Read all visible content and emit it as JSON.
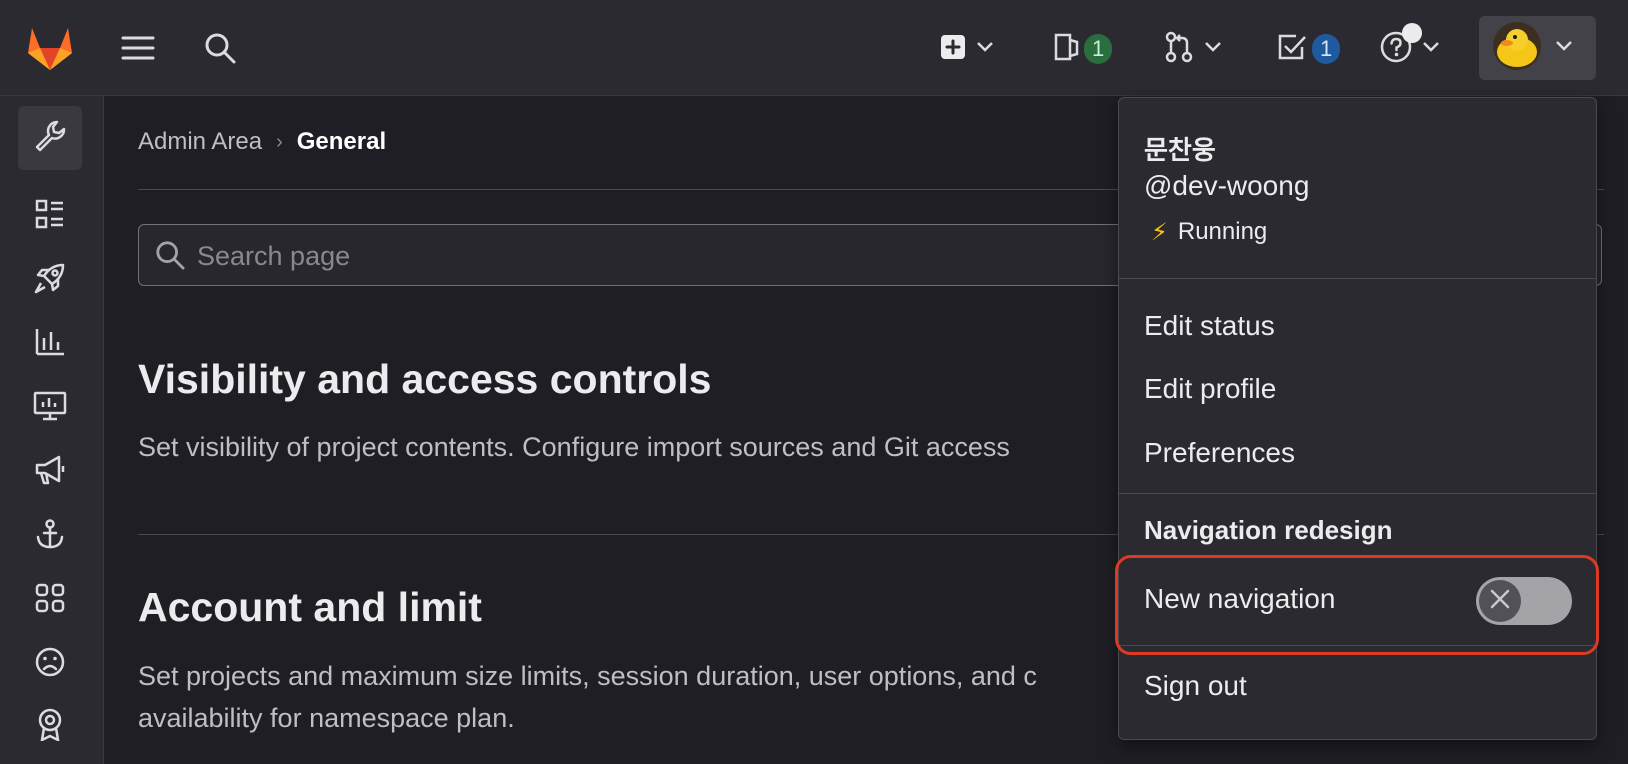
{
  "colors": {
    "brand_orange": "#fc6d26",
    "issues_badge": "#2a6e3f",
    "todos_badge": "#1f5a9e",
    "highlight_red": "#dc3b22"
  },
  "topbar": {
    "logo_icon": "gitlab-logo",
    "menu_icon": "hamburger-icon",
    "search_icon": "search-icon",
    "create_icon": "plus-square-icon",
    "issues_icon": "issues-icon",
    "issues_count": "1",
    "merge_requests_icon": "merge-request-icon",
    "todos_icon": "todo-checkbox-icon",
    "todos_count": "1",
    "help_icon": "question-circle-icon",
    "avatar_icon": "duck-avatar"
  },
  "sidebar": {
    "items": [
      {
        "icon": "wrench-icon"
      },
      {
        "icon": "overview-list-icon"
      },
      {
        "icon": "rocket-icon"
      },
      {
        "icon": "analytics-icon"
      },
      {
        "icon": "monitor-icon"
      },
      {
        "icon": "megaphone-icon"
      },
      {
        "icon": "anchor-icon"
      },
      {
        "icon": "apps-grid-icon"
      },
      {
        "icon": "abuse-face-icon"
      },
      {
        "icon": "badge-icon"
      }
    ]
  },
  "breadcrumb": {
    "parent": "Admin Area",
    "separator": "›",
    "current": "General"
  },
  "search": {
    "placeholder": "Search page",
    "value": ""
  },
  "sections": [
    {
      "title": "Visibility and access controls",
      "description": "Set visibility of project contents. Configure import sources and Git access"
    },
    {
      "title": "Account and limit",
      "description": "Set projects and maximum size limits, session duration, user options, and c",
      "description_line2": "availability for namespace plan."
    }
  ],
  "user_menu": {
    "name": "문찬웅",
    "username": "@dev-woong",
    "status_emoji": "⚡",
    "status_text": "Running",
    "edit_status": "Edit status",
    "edit_profile": "Edit profile",
    "preferences": "Preferences",
    "nav_redesign_heading": "Navigation redesign",
    "new_navigation_label": "New navigation",
    "new_navigation_enabled": false,
    "sign_out": "Sign out"
  }
}
